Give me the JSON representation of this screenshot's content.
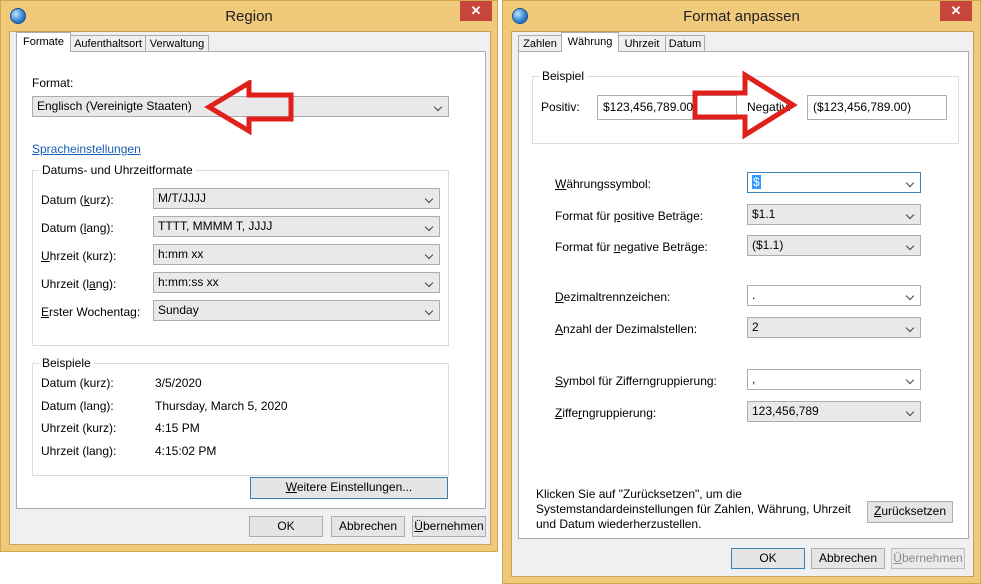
{
  "region": {
    "title": "Region",
    "close": "✕",
    "tabs": [
      "Formate",
      "Aufenthaltsort",
      "Verwaltung"
    ],
    "format_label": "Format:",
    "format_value": "Englisch (Vereinigte Staaten)",
    "language_link": "Spracheinstellungen",
    "datetime_group": "Datums- und Uhrzeitformate",
    "rows": [
      {
        "label": "Datum (kurz):",
        "value": "M/T/JJJJ"
      },
      {
        "label": "Datum (lang):",
        "value": "TTTT, MMMM T, JJJJ"
      },
      {
        "label": "Uhrzeit (kurz):",
        "value": "h:mm xx"
      },
      {
        "label": "Uhrzeit (lang):",
        "value": "h:mm:ss xx"
      },
      {
        "label": "Erster Wochentag:",
        "value": "Sunday"
      }
    ],
    "examples_group": "Beispiele",
    "examples": [
      {
        "label": "Datum (kurz):",
        "value": "3/5/2020"
      },
      {
        "label": "Datum (lang):",
        "value": "Thursday, March 5, 2020"
      },
      {
        "label": "Uhrzeit (kurz):",
        "value": "4:15 PM"
      },
      {
        "label": "Uhrzeit (lang):",
        "value": "4:15:02 PM"
      }
    ],
    "more_settings": "Weitere Einstellungen...",
    "ok": "OK",
    "cancel": "Abbrechen",
    "apply": "Übernehmen"
  },
  "format": {
    "title": "Format anpassen",
    "close": "✕",
    "tabs": [
      "Zahlen",
      "Währung",
      "Uhrzeit",
      "Datum"
    ],
    "example_group": "Beispiel",
    "positive_label": "Positiv:",
    "positive_value": "$123,456,789.00",
    "negative_label": "Negativ:",
    "negative_value": "($123,456,789.00)",
    "settings": [
      {
        "label": "Währungssymbol:",
        "value": "$"
      },
      {
        "label": "Format für positive Beträge:",
        "value": "$1.1"
      },
      {
        "label": "Format für negative Beträge:",
        "value": "($1.1)"
      },
      {
        "label": "Dezimaltrennzeichen:",
        "value": "."
      },
      {
        "label": "Anzahl der Dezimalstellen:",
        "value": "2"
      },
      {
        "label": "Symbol für Zifferngruppierung:",
        "value": ","
      },
      {
        "label": "Zifferngruppierung:",
        "value": "123,456,789"
      }
    ],
    "reset_text": "Klicken Sie auf \"Zurücksetzen\", um die Systemstandardeinstellungen für Zahlen, Währung, Uhrzeit und Datum wiederherzustellen.",
    "reset": "Zurücksetzen",
    "ok": "OK",
    "cancel": "Abbrechen",
    "apply": "Übernehmen"
  },
  "colors": {
    "arrow": "#e0201b",
    "frame": "#f0c97a",
    "close": "#c7453a",
    "link": "#1a5fb4"
  }
}
